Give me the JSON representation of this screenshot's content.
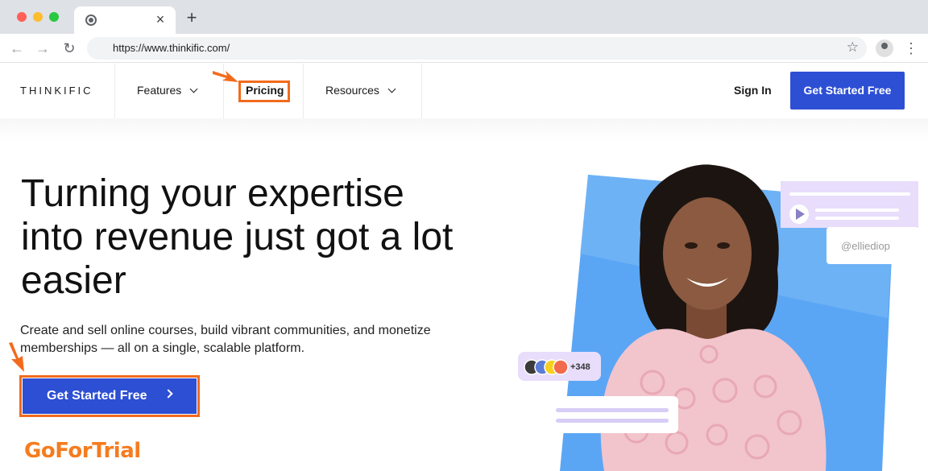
{
  "browser": {
    "url": "https://www.thinkific.com/",
    "tab_close": "×",
    "new_tab": "+",
    "back": "←",
    "forward": "→",
    "reload": "↻",
    "star": "☆",
    "menu": "⋮"
  },
  "header": {
    "logo": "THINKIFIC",
    "nav": {
      "features": "Features",
      "pricing": "Pricing",
      "resources": "Resources"
    },
    "sign_in": "Sign In",
    "cta": "Get Started Free"
  },
  "hero": {
    "title": "Turning your expertise into revenue just got a lot easier",
    "subtitle": "Create and sell online courses, build vibrant communities, and monetize memberships — all on a single, scalable platform.",
    "cta": "Get Started Free",
    "handle": "@elliediop",
    "avatar_count": "+348"
  },
  "watermark": "GoForTrial",
  "colors": {
    "brand_blue": "#2d4fd4",
    "highlight_orange": "#f26b1d",
    "art_blue": "#5aa6f5",
    "art_lavender": "#e8ddfb"
  }
}
